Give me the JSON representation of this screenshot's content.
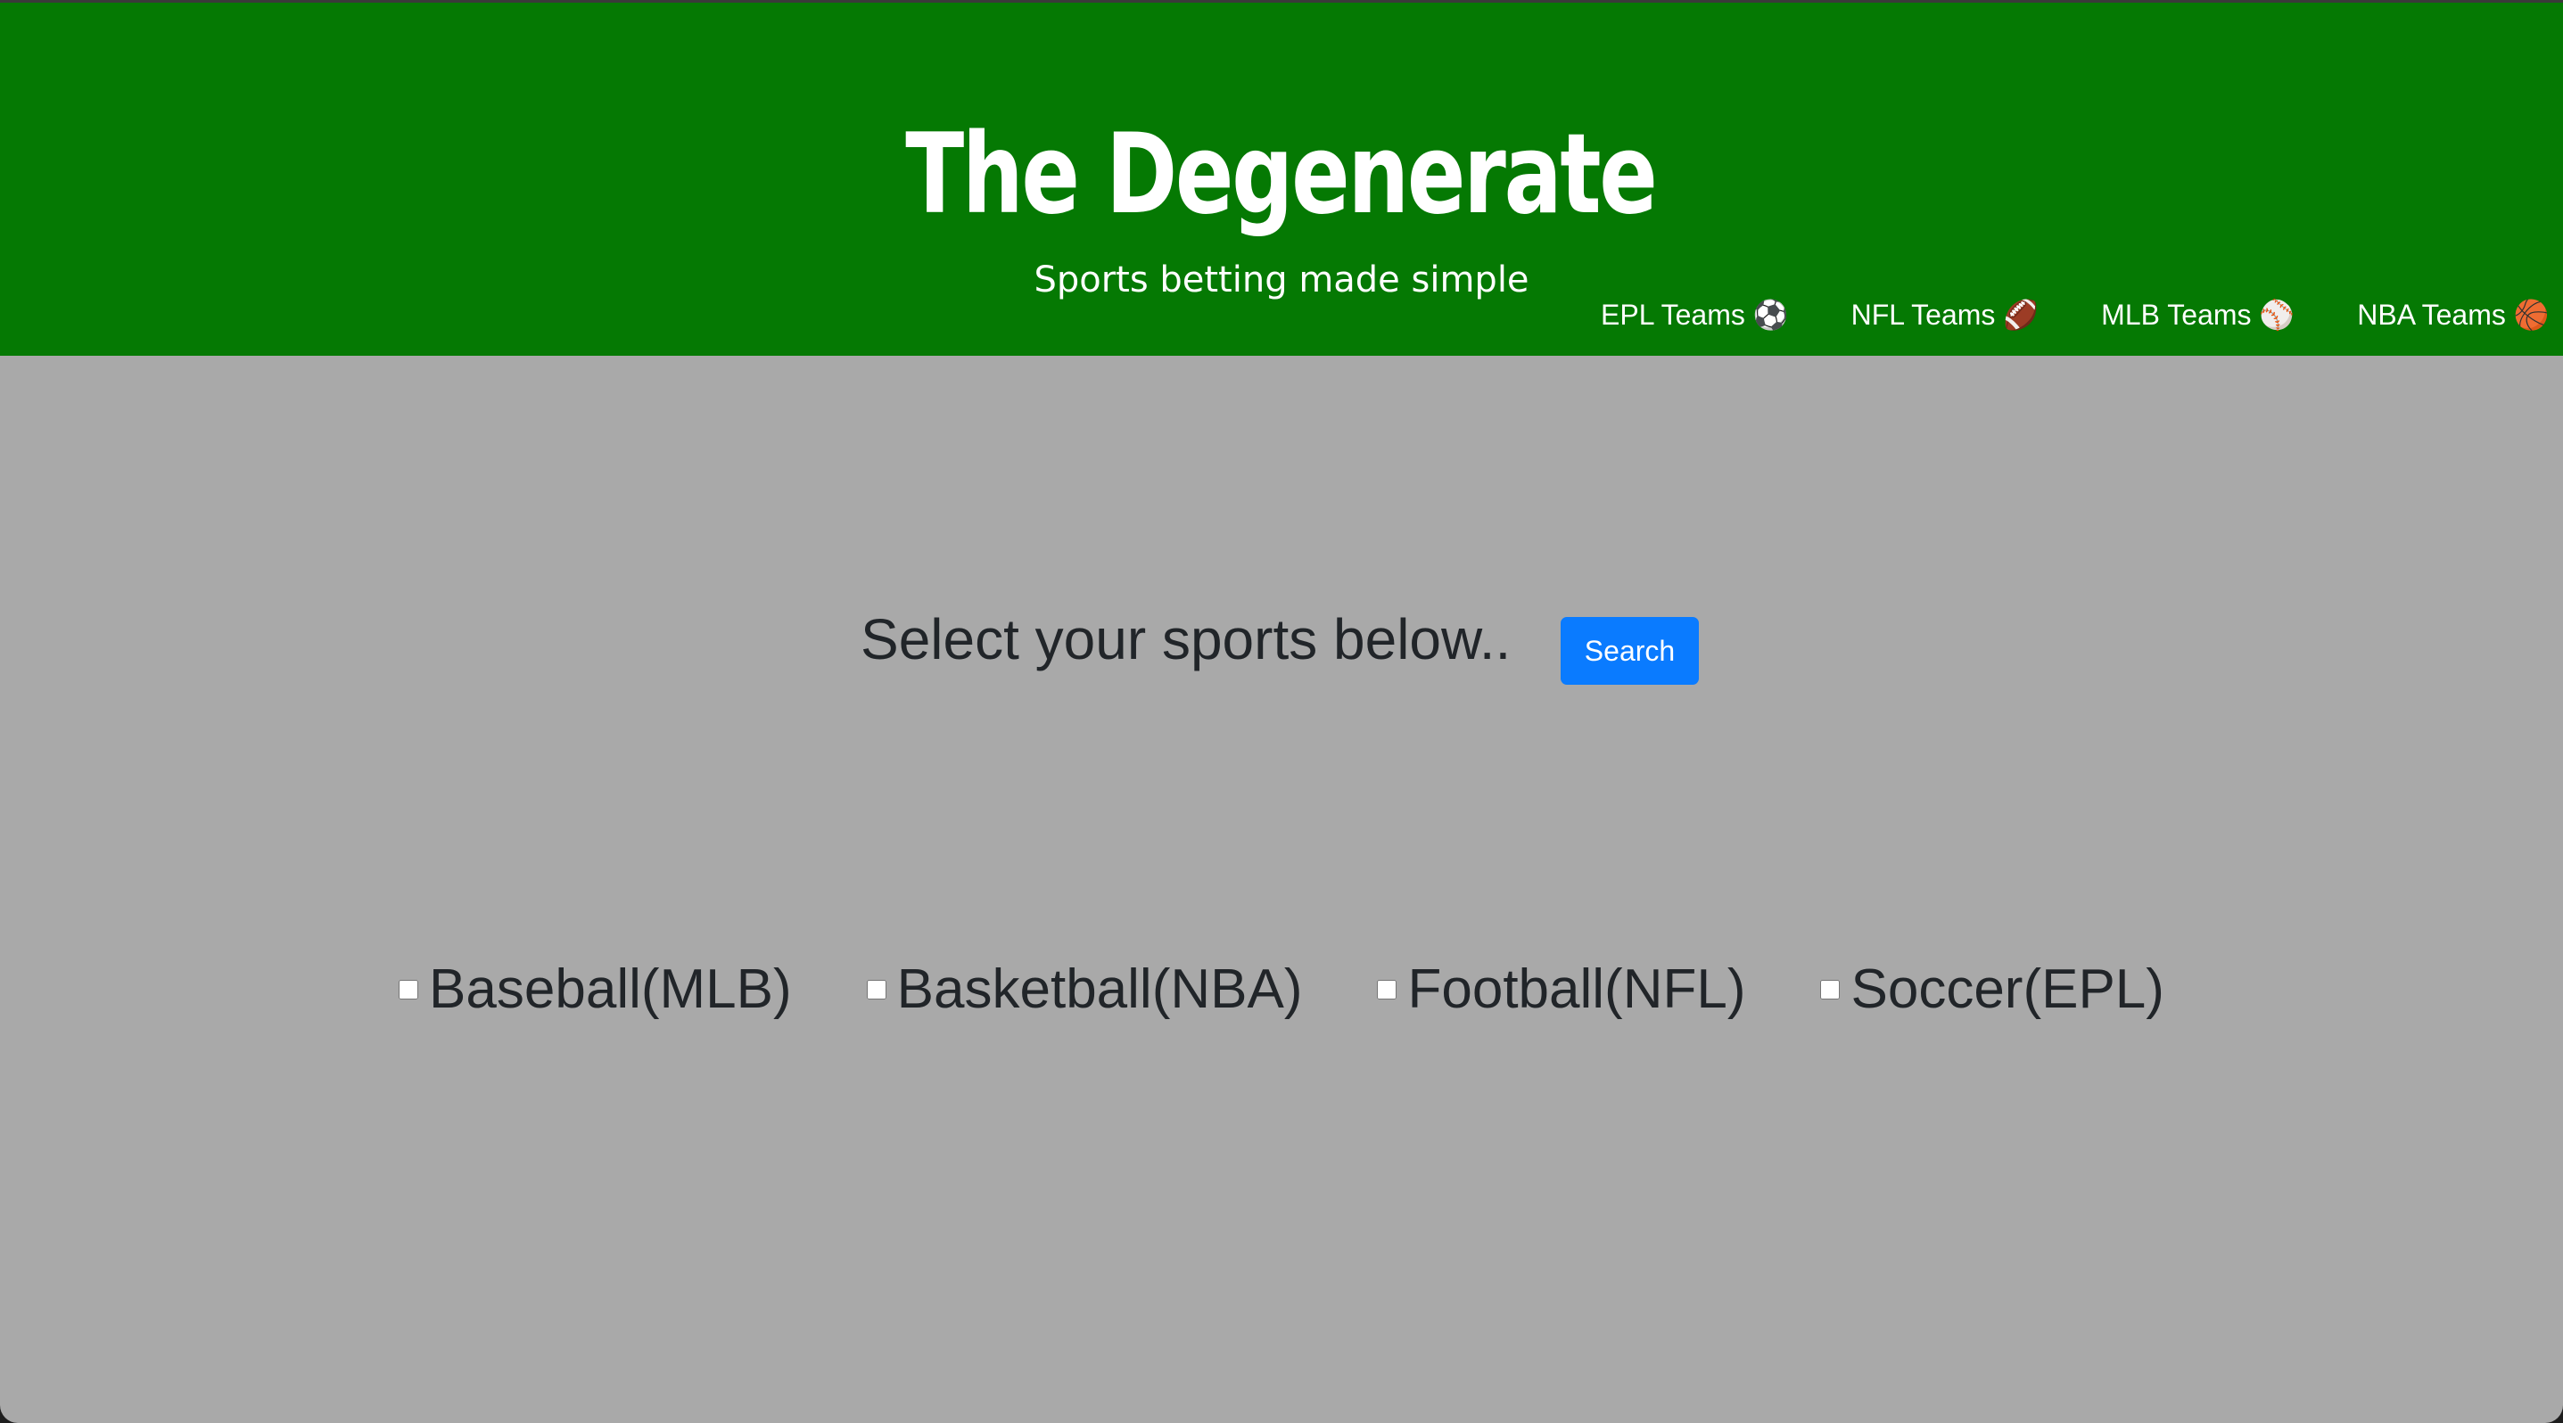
{
  "header": {
    "title": "The Degenerate",
    "tagline": "Sports betting made simple",
    "nav": [
      {
        "label": "EPL Teams ⚽"
      },
      {
        "label": "NFL Teams 🏈"
      },
      {
        "label": "MLB Teams ⚾"
      },
      {
        "label": "NBA Teams 🏀"
      }
    ]
  },
  "main": {
    "prompt": "Select your sports below..",
    "search_label": "Search",
    "sports": [
      {
        "label": "Baseball(MLB)",
        "checked": false
      },
      {
        "label": "Basketball(NBA)",
        "checked": false
      },
      {
        "label": "Football(NFL)",
        "checked": false
      },
      {
        "label": "Soccer(EPL)",
        "checked": false
      }
    ]
  },
  "colors": {
    "header_bg": "#057903",
    "page_bg": "#a9a9a9",
    "button_bg": "#0a7bff",
    "text_dark": "#212529"
  }
}
